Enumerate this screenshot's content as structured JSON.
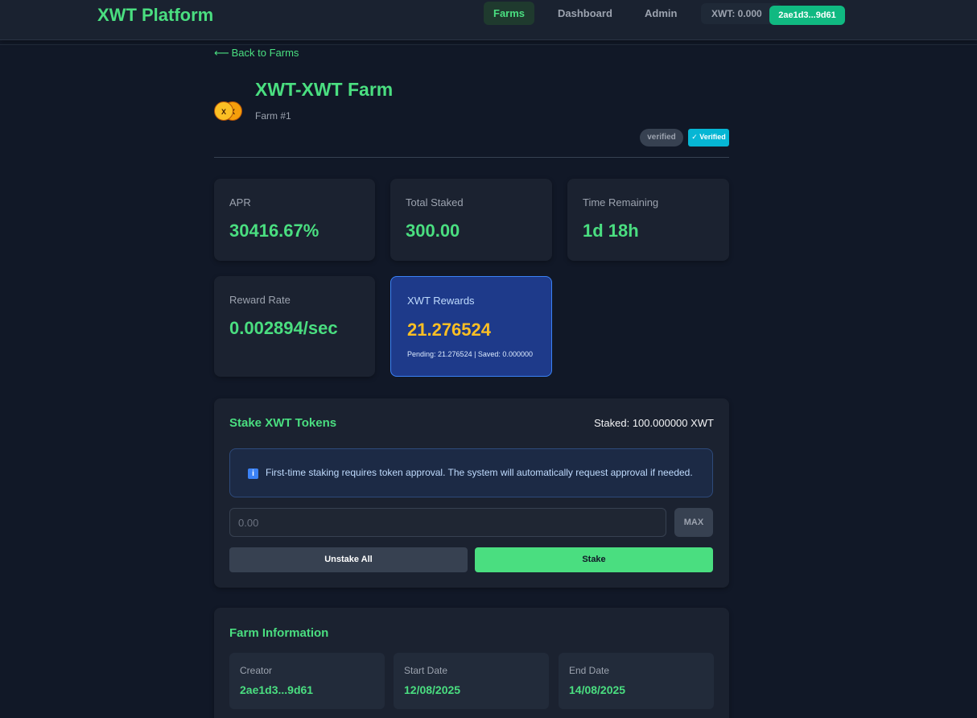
{
  "header": {
    "brand": "XWT Platform",
    "nav": [
      {
        "label": "Farms",
        "active": true
      },
      {
        "label": "Dashboard",
        "active": false
      },
      {
        "label": "Admin",
        "active": false
      }
    ],
    "balance": "XWT: 0.000",
    "wallet": "2ae1d3...9d61"
  },
  "back_link": "Back to Farms",
  "farm": {
    "token_a": "X",
    "token_b": "X",
    "title": "XWT-XWT Farm",
    "subtitle": "Farm #1",
    "status_badge": "verified",
    "verified_badge": "✓ Verified"
  },
  "stats": [
    {
      "label": "APR",
      "value": "30416.67%"
    },
    {
      "label": "Total Staked",
      "value": "300.00"
    },
    {
      "label": "Time Remaining",
      "value": "1d 18h"
    },
    {
      "label": "Reward Rate",
      "value": "0.002894/sec"
    }
  ],
  "rewards": {
    "label": "XWT Rewards",
    "value": "21.276524",
    "detail": "Pending: 21.276524 | Saved: 0.000000"
  },
  "stake": {
    "title": "Stake XWT Tokens",
    "staked": "Staked: 100.000000 XWT",
    "info": "First-time staking requires token approval. The system will automatically request approval if needed.",
    "input_placeholder": "0.00",
    "max_label": "MAX",
    "unstake_label": "Unstake All",
    "stake_label": "Stake"
  },
  "farm_info": {
    "title": "Farm Information",
    "tiles": [
      {
        "label": "Creator",
        "value": "2ae1d3...9d61"
      },
      {
        "label": "Start Date",
        "value": "12/08/2025"
      },
      {
        "label": "End Date",
        "value": "14/08/2025"
      }
    ]
  },
  "colors": {
    "accent": "#4ade80",
    "wallet": "#10b981",
    "rewards_bg": "#1e3a8a",
    "rewards_value": "#fbbf24",
    "verified": "#06b6d4"
  }
}
